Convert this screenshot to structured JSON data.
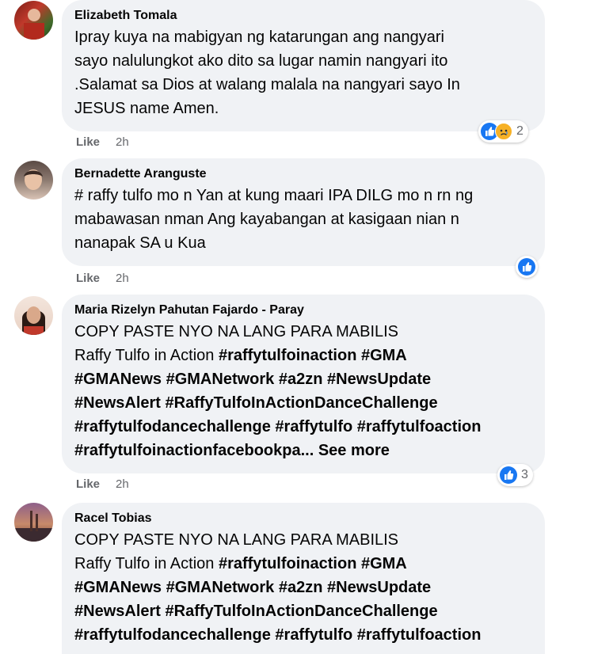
{
  "comments": [
    {
      "author": "Elizabeth Tomala",
      "lines": [
        [
          {
            "t": "Ipray kuya na mabigyan ng katarungan ang nangyari",
            "b": false
          }
        ],
        [
          {
            "t": "sayo nalulungkot ako dito sa lugar namin nangyari ito",
            "b": false
          }
        ],
        [
          {
            "t": ".Salamat sa Dios at walang malala na nangyari sayo In",
            "b": false
          }
        ],
        [
          {
            "t": "JESUS name Amen.",
            "b": false
          }
        ]
      ],
      "like_label": "Like",
      "time": "2h",
      "reactions": [
        "like-icon",
        "sad-icon"
      ],
      "reaction_count": "2"
    },
    {
      "author": "Bernadette Aranguste",
      "lines": [
        [
          {
            "t": "# raffy tulfo mo n Yan at kung maari IPA DILG mo n rn ng",
            "b": false
          }
        ],
        [
          {
            "t": "mabawasan nman Ang kayabangan at kasigaan nian n",
            "b": false
          }
        ],
        [
          {
            "t": "nanapak SA u Kua",
            "b": false
          }
        ]
      ],
      "like_label": "Like",
      "time": "2h",
      "reactions": [
        "like-icon"
      ],
      "reaction_count": ""
    },
    {
      "author": "Maria Rizelyn Pahutan Fajardo - Paray",
      "lines": [
        [
          {
            "t": "COPY PASTE NYO NA LANG PARA MABILIS",
            "b": false
          }
        ],
        [
          {
            "t": "Raffy Tulfo in Action ",
            "b": false
          },
          {
            "t": "#raffytulfoinaction",
            "b": true
          },
          {
            "t": " ",
            "b": false
          },
          {
            "t": "#GMA",
            "b": true
          }
        ],
        [
          {
            "t": "#GMANews",
            "b": true
          },
          {
            "t": " ",
            "b": false
          },
          {
            "t": "#GMANetwork",
            "b": true
          },
          {
            "t": " ",
            "b": false
          },
          {
            "t": "#a2zn",
            "b": true
          },
          {
            "t": " ",
            "b": false
          },
          {
            "t": "#NewsUpdate",
            "b": true
          }
        ],
        [
          {
            "t": "#NewsAlert",
            "b": true
          },
          {
            "t": " ",
            "b": false
          },
          {
            "t": "#RaffyTulfoInActionDanceChallenge",
            "b": true
          }
        ],
        [
          {
            "t": "#raffytulfodancechallenge",
            "b": true
          },
          {
            "t": " ",
            "b": false
          },
          {
            "t": "#raffytulfo",
            "b": true
          },
          {
            "t": " ",
            "b": false
          },
          {
            "t": "#raffytulfoaction",
            "b": true
          }
        ],
        [
          {
            "t": "#raffytulfoinactionfacebookpa...",
            "b": true
          },
          {
            "t": " ",
            "b": false
          },
          {
            "t": "See more",
            "b": true,
            "more": true
          }
        ]
      ],
      "like_label": "Like",
      "time": "2h",
      "reactions": [
        "like-icon"
      ],
      "reaction_count": "3"
    },
    {
      "author": "Racel Tobias",
      "lines": [
        [
          {
            "t": "COPY PASTE NYO NA LANG PARA MABILIS",
            "b": false
          }
        ],
        [
          {
            "t": "Raffy Tulfo in Action ",
            "b": false
          },
          {
            "t": "#raffytulfoinaction",
            "b": true
          },
          {
            "t": " ",
            "b": false
          },
          {
            "t": "#GMA",
            "b": true
          }
        ],
        [
          {
            "t": "#GMANews",
            "b": true
          },
          {
            "t": " ",
            "b": false
          },
          {
            "t": "#GMANetwork",
            "b": true
          },
          {
            "t": " ",
            "b": false
          },
          {
            "t": "#a2zn",
            "b": true
          },
          {
            "t": " ",
            "b": false
          },
          {
            "t": "#NewsUpdate",
            "b": true
          }
        ],
        [
          {
            "t": "#NewsAlert",
            "b": true
          },
          {
            "t": " ",
            "b": false
          },
          {
            "t": "#RaffyTulfoInActionDanceChallenge",
            "b": true
          }
        ],
        [
          {
            "t": "#raffytulfodancechallenge",
            "b": true
          },
          {
            "t": " ",
            "b": false
          },
          {
            "t": "#raffytulfo",
            "b": true
          },
          {
            "t": " ",
            "b": false
          },
          {
            "t": "#raffytulfoaction",
            "b": true
          }
        ]
      ],
      "like_label": "",
      "time": "",
      "reactions": [],
      "reaction_count": ""
    }
  ],
  "colors": {
    "bubble": "#f0f2f5",
    "like_blue": "#1877f2",
    "sad_yellow": "#f7b125",
    "meta_gray": "#65676b"
  }
}
